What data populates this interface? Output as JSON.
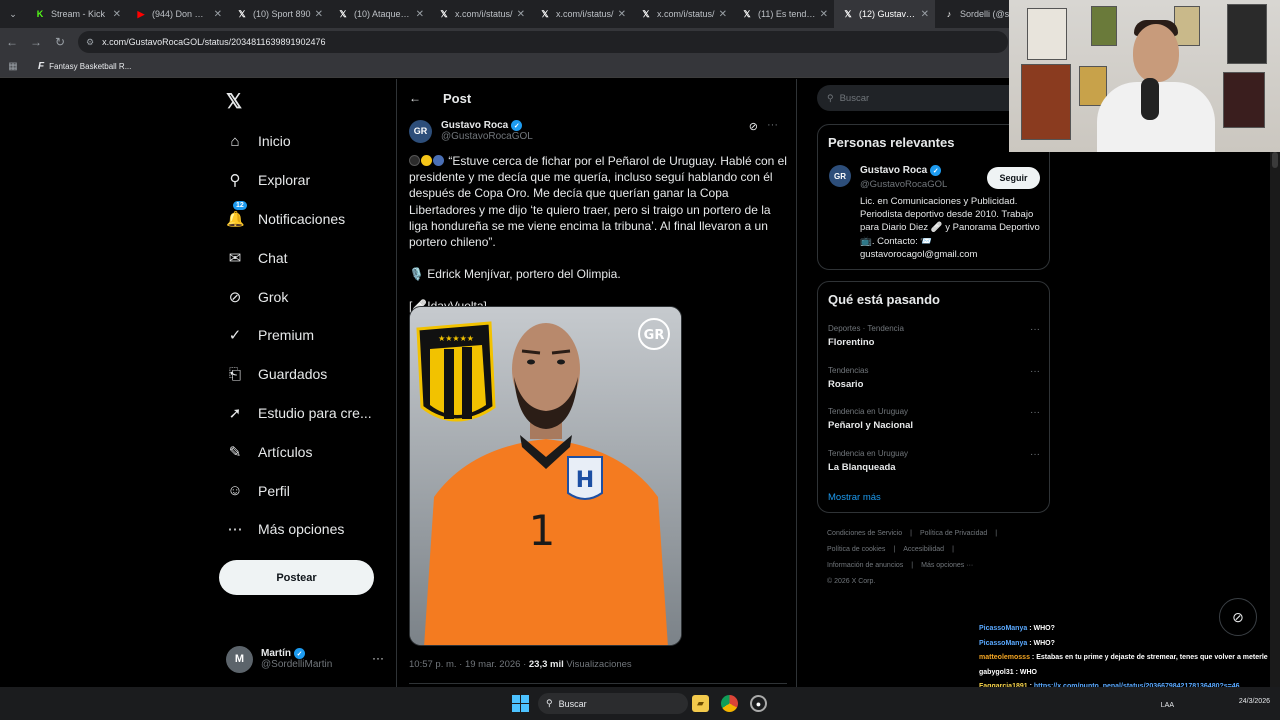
{
  "browser": {
    "tabs": [
      {
        "title": "Stream - Kick",
        "icon": "kick-icon",
        "color": "#53fc18",
        "glyph": "K"
      },
      {
        "title": "(944) Don Oma",
        "icon": "youtube-icon",
        "color": "#ff0000",
        "glyph": "▶"
      },
      {
        "title": "(10) Sport 890",
        "icon": "x-logo-icon",
        "color": "#ffffff",
        "glyph": "𝕏"
      },
      {
        "title": "(10) Ataque Fu",
        "icon": "x-logo-icon",
        "color": "#ffffff",
        "glyph": "𝕏"
      },
      {
        "title": "x.com/i/status/",
        "icon": "x-logo-icon",
        "color": "#ffffff",
        "glyph": "𝕏"
      },
      {
        "title": "x.com/i/status/",
        "icon": "x-logo-icon",
        "color": "#ffffff",
        "glyph": "𝕏"
      },
      {
        "title": "x.com/i/status/",
        "icon": "x-logo-icon",
        "color": "#ffffff",
        "glyph": "𝕏"
      },
      {
        "title": "(11) Es tenden",
        "icon": "x-logo-icon",
        "color": "#ffffff",
        "glyph": "𝕏"
      },
      {
        "title": "(12) Gustavo R",
        "icon": "x-logo-icon",
        "color": "#ffffff",
        "glyph": "𝕏",
        "active": true
      },
      {
        "title": "Sordelli (@sor",
        "icon": "tiktok-icon",
        "color": "#ffffff",
        "glyph": "♪"
      }
    ],
    "url": "x.com/GustavoRocaGOL/status/2034811639891902476",
    "bookmark": "Fantasy Basketball R..."
  },
  "nav": {
    "items": [
      {
        "label": "Inicio",
        "icon": "home-icon",
        "glyph": "⌂"
      },
      {
        "label": "Explorar",
        "icon": "search-icon",
        "glyph": "⚲"
      },
      {
        "label": "Notificaciones",
        "icon": "bell-icon",
        "glyph": "🔔",
        "badge": "12"
      },
      {
        "label": "Chat",
        "icon": "mail-icon",
        "glyph": "✉"
      },
      {
        "label": "Grok",
        "icon": "grok-icon",
        "glyph": "⊘"
      },
      {
        "label": "Premium",
        "icon": "premium-icon",
        "glyph": "✓"
      },
      {
        "label": "Guardados",
        "icon": "bookmark-icon",
        "glyph": "⎗"
      },
      {
        "label": "Estudio para cre...",
        "icon": "rocket-icon",
        "glyph": "➚"
      },
      {
        "label": "Artículos",
        "icon": "article-icon",
        "glyph": "✎"
      },
      {
        "label": "Perfil",
        "icon": "person-icon",
        "glyph": "☺"
      },
      {
        "label": "Más opciones",
        "icon": "more-icon",
        "glyph": "⋯"
      }
    ],
    "post_button": "Postear",
    "account": {
      "name": "Martín",
      "handle": "@SordelliMartin",
      "initial": "M"
    }
  },
  "post": {
    "header": "Post",
    "author": {
      "name": "Gustavo Roca",
      "handle": "@GustavoRocaGOL",
      "initial": "GR"
    },
    "text1": "“Estuve cerca de fichar por el Peñarol de Uruguay. Hablé con el presidente y me decía que me quería, incluso seguí hablando con él después de Copa Oro. Me decía que querían ganar la Copa Libertadores y me dijo ‘te quiero traer, pero si traigo un portero de la liga hondureña se me viene encima la tribuna’. Al final llevaron a un portero chileno”.",
    "text2": "🎙️ Edrick Menjívar, portero del Olimpia.",
    "text3": "[🩹IdayVuelta]",
    "time": "10:57 p. m. · 19 mar. 2026 · ",
    "views_count": "23,3 mil",
    "views_label": " Visualizaciones",
    "media_watermark": "GR",
    "jersey_number": "1"
  },
  "sidebar": {
    "search_placeholder": "Buscar",
    "relevant": {
      "title": "Personas relevantes",
      "name": "Gustavo Roca",
      "handle": "@GustavoRocaGOL",
      "initial": "GR",
      "follow": "Seguir",
      "bio": "Lic. en Comunicaciones y Publicidad. Periodista deportivo desde 2010. Trabajo para Diario Diez 🩹 y Panorama Deportivo 📺. Contacto: 📨 gustavorocagol@gmail.com"
    },
    "trending": {
      "title": "Qué está pasando",
      "items": [
        {
          "category": "Deportes · Tendencia",
          "name": "Florentino"
        },
        {
          "category": "Tendencias",
          "name": "Rosario"
        },
        {
          "category": "Tendencia en Uruguay",
          "name": "Peñarol y Nacional"
        },
        {
          "category": "Tendencia en Uruguay",
          "name": "La Blanqueada"
        }
      ],
      "show_more": "Mostrar más"
    },
    "footer": {
      "links": [
        "Condiciones de Servicio",
        "|",
        "Política de Privacidad",
        "|",
        "Política de cookies",
        "|",
        "Accesibilidad",
        "|",
        "Información de anuncios",
        "|",
        "Más opciones ···",
        "© 2026 X Corp."
      ]
    }
  },
  "stream_chat": [
    {
      "user": "PicassoManya",
      "msg": "WHO?",
      "color": "u1"
    },
    {
      "user": "PicassoManya",
      "msg": "WHO?",
      "color": "u1"
    },
    {
      "user": "matteolemosss",
      "msg": "Estabas en tu prime y dejaste de stremear, tenes que volver a meterle",
      "color": "u2"
    },
    {
      "user": "gabygol31",
      "msg": "WHO",
      "color": "u3"
    },
    {
      "user": "Faqgarcia1891",
      "msg": "https://x.com/punto_penal/status/2036679842178136480?s=46",
      "color": "u4"
    }
  ],
  "taskbar": {
    "search": "Buscar",
    "lang": "LAA",
    "time": "",
    "date": "24/3/2026"
  }
}
